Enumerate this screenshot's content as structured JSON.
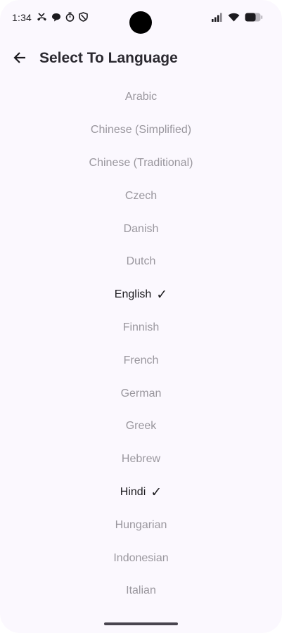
{
  "status_bar": {
    "time": "1:34",
    "left_icons": [
      "missed-call-icon",
      "chat-bubble-icon",
      "timer-icon",
      "shield-icon"
    ],
    "right_icons": [
      "signal-icon",
      "wifi-icon",
      "battery-icon"
    ]
  },
  "header": {
    "back_icon": "arrow-back-icon",
    "title": "Select To Language"
  },
  "languages": [
    {
      "label": "Arabic",
      "selected": false
    },
    {
      "label": "Chinese (Simplified)",
      "selected": false
    },
    {
      "label": "Chinese (Traditional)",
      "selected": false
    },
    {
      "label": "Czech",
      "selected": false
    },
    {
      "label": "Danish",
      "selected": false
    },
    {
      "label": "Dutch",
      "selected": false
    },
    {
      "label": "English",
      "selected": true
    },
    {
      "label": "Finnish",
      "selected": false
    },
    {
      "label": "French",
      "selected": false
    },
    {
      "label": "German",
      "selected": false
    },
    {
      "label": "Greek",
      "selected": false
    },
    {
      "label": "Hebrew",
      "selected": false
    },
    {
      "label": "Hindi",
      "selected": true
    },
    {
      "label": "Hungarian",
      "selected": false
    },
    {
      "label": "Indonesian",
      "selected": false
    },
    {
      "label": "Italian",
      "selected": false
    }
  ],
  "check_glyph": "✓",
  "colors": {
    "background": "#fbf8fe",
    "selected_text": "#1c1b1f",
    "unselected_text": "#9a979e"
  }
}
